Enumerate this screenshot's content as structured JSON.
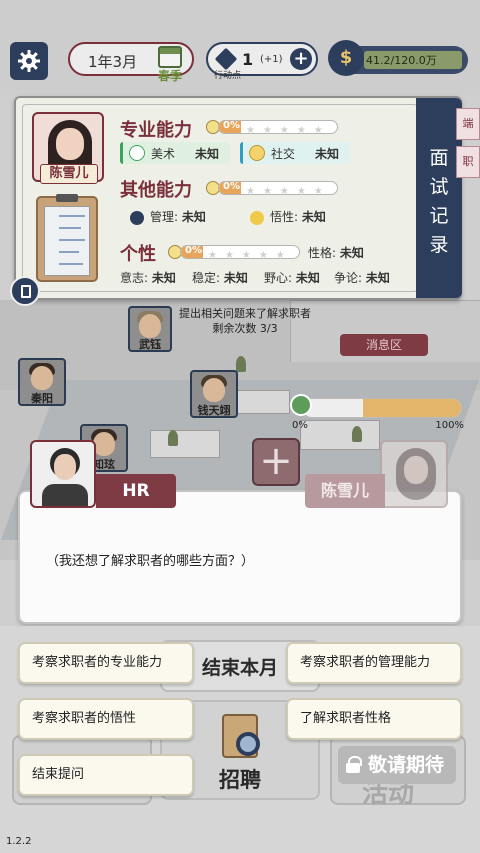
{
  "topbar": {
    "date": "1年3月",
    "season": "春季",
    "action_points": "1",
    "action_points_bonus": "(+1)",
    "action_points_label": "行动点",
    "money": "41.2/120.0万"
  },
  "panel": {
    "candidate_name": "陈雪儿",
    "side_tab": [
      "面",
      "试",
      "记",
      "录"
    ],
    "side_tabs_right": [
      "端",
      "职"
    ],
    "professional": {
      "title": "专业能力",
      "percent": "0%",
      "progress": 0,
      "stars": 5,
      "skills": [
        {
          "label": "美术",
          "value": "未知"
        },
        {
          "label": "社交",
          "value": "未知"
        }
      ]
    },
    "other": {
      "title": "其他能力",
      "percent": "0%",
      "progress": 0,
      "stars": 5,
      "items": [
        {
          "label": "管理:",
          "value": "未知"
        },
        {
          "label": "悟性:",
          "value": "未知"
        }
      ]
    },
    "personality": {
      "title": "个性",
      "percent": "0%",
      "progress": 0,
      "stars": 5,
      "trait_label": "性格:",
      "trait_value": "未知",
      "attrs": [
        {
          "label": "意志:",
          "value": "未知"
        },
        {
          "label": "稳定:",
          "value": "未知"
        },
        {
          "label": "野心:",
          "value": "未知"
        },
        {
          "label": "争论:",
          "value": "未知"
        }
      ]
    }
  },
  "office": {
    "prompt_line1": "提出相关问题来了解求职者",
    "prompt_line2": "剩余次数 3/3",
    "message_area": "消息区",
    "employees": [
      "武钰",
      "秦阳",
      "钱天翊",
      "知玹"
    ],
    "progress_min": "0%",
    "progress_max": "100%",
    "progress_value": 0.38
  },
  "dialog": {
    "hr_label": "HR",
    "candidate_label": "陈雪儿",
    "text": "（我还想了解求职者的哪些方面？）"
  },
  "options": [
    "考察求职者的专业能力",
    "考察求职者的管理能力",
    "考察求职者的悟性",
    "了解求职者性格",
    "结束提问"
  ],
  "bottom": {
    "end_month": "结束本月",
    "recruit": "招聘",
    "coming_soon": "敬请期待",
    "activity": "活动"
  },
  "version": "1.2.2",
  "colors": {
    "navy": "#2c3e5c",
    "maroon": "#7a2f3a",
    "progress": "#e2b56a"
  }
}
